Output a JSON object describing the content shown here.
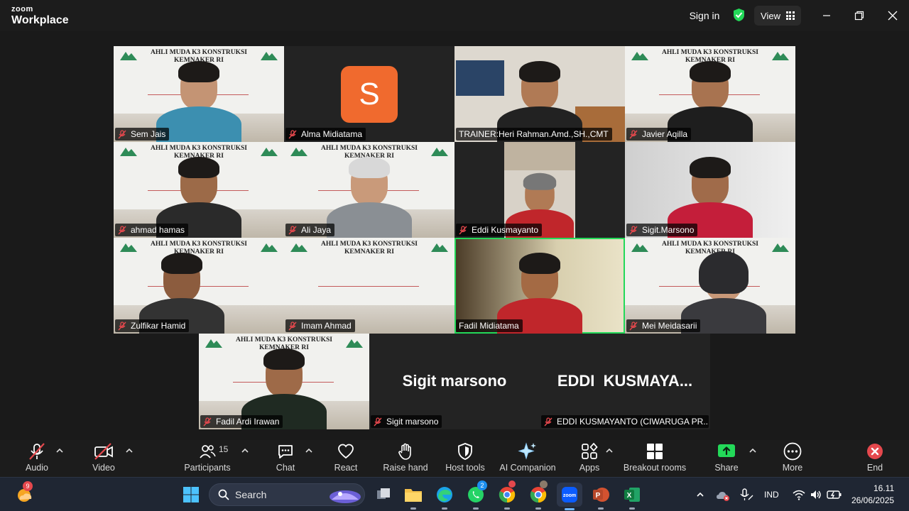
{
  "titlebar": {
    "brand_small": "zoom",
    "brand_big": "Workplace",
    "signin": "Sign in",
    "view": "View"
  },
  "slide": {
    "header_line1": "AHLI MUDA K3 KONSTRUKSI",
    "header_line2": "KEMNAKER RI"
  },
  "participants": [
    {
      "name": "Sem Jais"
    },
    {
      "name": "Alma Midiatama",
      "initial": "S"
    },
    {
      "name": "TRAINER:Heri Rahman.Amd.,SH.,CMT"
    },
    {
      "name": "Javier Aqilla"
    },
    {
      "name": "ahmad hamas"
    },
    {
      "name": "Ali Jaya"
    },
    {
      "name": "Eddi Kusmayanto"
    },
    {
      "name": "Sigit.Marsono"
    },
    {
      "name": "Zulfikar Hamid"
    },
    {
      "name": "Imam Ahmad"
    },
    {
      "name": "Fadil Midiatama"
    },
    {
      "name": "Mei Meidasarii"
    },
    {
      "name": "Fadil Ardi Irawan"
    },
    {
      "name": "Sigit marsono",
      "display": "Sigit marsono"
    },
    {
      "name": "EDDI KUSMAYANTO (CIWARUGA PR...",
      "display": "EDDI  KUSMAYA..."
    }
  ],
  "toolbar": {
    "audio": "Audio",
    "video": "Video",
    "participants": "Participants",
    "participants_count": "15",
    "chat": "Chat",
    "react": "React",
    "raise_hand": "Raise hand",
    "host_tools": "Host tools",
    "ai_companion": "AI Companion",
    "apps": "Apps",
    "breakout_rooms": "Breakout rooms",
    "share": "Share",
    "more": "More",
    "end": "End"
  },
  "taskbar": {
    "weather_badge": "9",
    "search": "Search",
    "whatsapp_badge": "2",
    "lang": "IND",
    "time": "16.11",
    "date": "26/06/2025"
  },
  "colors": {
    "active_speaker": "#23d959",
    "zoom_avatar": "#f06a2e",
    "share_green": "#23d959",
    "end_red": "#e5484d"
  }
}
